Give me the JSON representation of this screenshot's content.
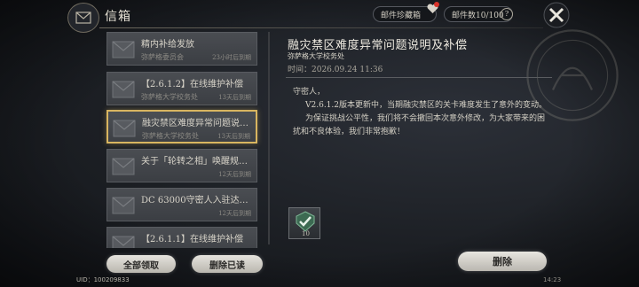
{
  "header": {
    "title": "信箱",
    "collection_label": "邮件珍藏箱",
    "mail_count_label": "邮件数10/100",
    "help_symbol": "?"
  },
  "mails": [
    {
      "title": "精内补给发放",
      "sender": "弥萨格委员会",
      "expire": "23小时后到期",
      "selected": false
    },
    {
      "title": "【2.6.1.2】在线维护补偿",
      "sender": "弥萨格大学校务处",
      "expire": "13天后到期",
      "selected": false
    },
    {
      "title": "融灾禁区难度异常问题说明…",
      "sender": "弥萨格大学校务处",
      "expire": "13天后到期",
      "selected": true
    },
    {
      "title": "关于「轮转之相」唤醒规则…",
      "sender": "",
      "expire": "12天后到期",
      "selected": false
    },
    {
      "title": "DC 63000守密人入驻达…",
      "sender": "",
      "expire": "12天后到期",
      "selected": false
    },
    {
      "title": "【2.6.1.1】在线维护补偿",
      "sender": "",
      "expire": "",
      "selected": false
    }
  ],
  "left_buttons": {
    "claim_all": "全部领取",
    "delete_read": "删除已读"
  },
  "detail": {
    "title": "融灾禁区难度异常问题说明及补偿",
    "sender": "弥萨格大学校务处",
    "time": "时间：2026.09.24 11:36",
    "greeting": "守密人，",
    "para1": "V2.6.1.2版本更新中，当期融灾禁区的关卡难度发生了意外的变动。",
    "para2": "为保证挑战公平性，我们将不会撤回本次意外修改，为大家带来的困扰和不良体验，我们非常抱歉！",
    "attachment_qty": "10",
    "delete_label": "删除"
  },
  "footer": {
    "uid": "UID：100209833",
    "clock": "14:23"
  },
  "colors": {
    "selected_border": "#d8b560",
    "notify_dot": "#d9342b",
    "attachment_icon": "#4d9a6b"
  }
}
